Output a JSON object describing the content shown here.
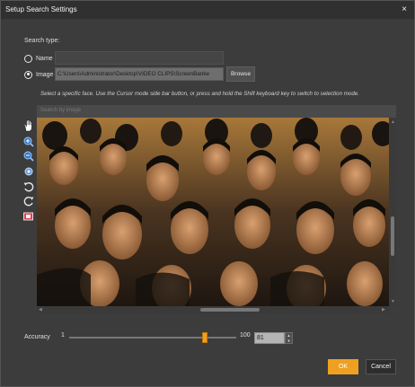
{
  "window": {
    "title": "Setup Search Settings",
    "close_glyph": "×"
  },
  "search_type": {
    "label": "Search type:",
    "options": [
      {
        "label": "Name",
        "selected": false
      },
      {
        "label": "Image",
        "selected": true
      }
    ],
    "name_value": "",
    "image_path": "C:\\Users\\Administrator\\Desktop\\VIDEO CLIPS\\ScreenBanke",
    "browse_label": "Browse"
  },
  "instruction": "Select a specific face. Use the Cursor mode side bar button, or press and hold the Shift keyboard key to switch to selection mode.",
  "image_header": "Search by image",
  "tools": [
    {
      "name": "hand-cursor-icon"
    },
    {
      "name": "zoom-in-icon"
    },
    {
      "name": "zoom-out-icon"
    },
    {
      "name": "fit-icon"
    },
    {
      "name": "rotate-left-icon"
    },
    {
      "name": "rotate-right-icon"
    },
    {
      "name": "clear-selection-icon"
    }
  ],
  "accuracy": {
    "label": "Accuracy",
    "min": "1",
    "max": "100",
    "value": "81",
    "slider_fraction": 0.81
  },
  "buttons": {
    "ok": "OK",
    "cancel": "Cancel"
  },
  "colors": {
    "accent": "#f0a020",
    "window_bg": "#3c3c3c"
  }
}
